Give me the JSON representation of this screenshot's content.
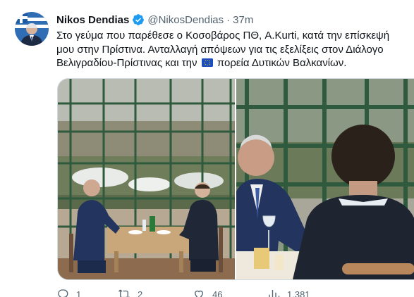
{
  "author": {
    "name": "Nikos Dendias",
    "handle": "@NikosDendias",
    "separator": "·",
    "time": "37m"
  },
  "tweet": {
    "text_part1": "Στο γεύμα που παρέθεσε ο Κοσοβάρος ΠΘ, ",
    "mention": "A.Kurti",
    "text_part2": ", κατά την επίσκεψή μου στην Πρίστινα. Ανταλλαγή απόψεων για τις εξελίξεις στον Διάλογο Βελιγραδίου-Πρίστινας και την ",
    "text_part3": " πορεία Δυτικών Βαλκανίων."
  },
  "actions": {
    "replies": "1",
    "retweets": "2",
    "likes": "46",
    "views": "1,381"
  },
  "colors": {
    "text": "#0f1419",
    "secondary": "#536471",
    "verified": "#1d9bf0",
    "border": "#cfd9de"
  },
  "icons": [
    "verified-badge-icon",
    "eu-flag-emoji",
    "reply-icon",
    "retweet-icon",
    "like-icon",
    "views-icon"
  ]
}
